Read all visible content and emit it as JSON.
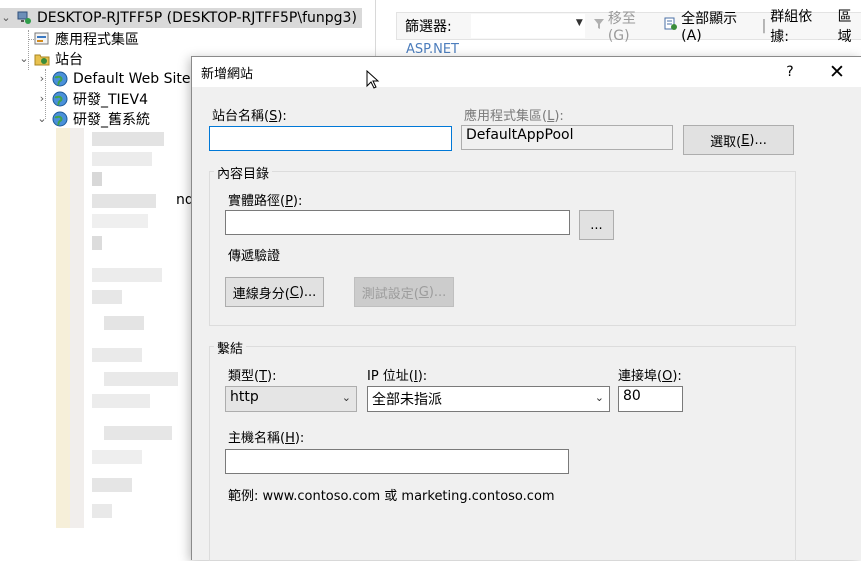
{
  "tree": {
    "server": "DESKTOP-RJTFF5P (DESKTOP-RJTFF5P\\funpg3)",
    "app_pools": "應用程式集區",
    "sites": "站台",
    "site_items": [
      {
        "label": "Default Web Site"
      },
      {
        "label": "研發_TIEV4"
      },
      {
        "label": "研發_舊系統"
      }
    ],
    "partial_text": "nd"
  },
  "right_pane": {
    "filter_label": "篩選器:",
    "go_label": "移至(G)",
    "show_all_label": "全部顯示(A)",
    "group_by_label": "群組依據:",
    "group_by_value": "區域",
    "section_label": "ASP.NET"
  },
  "dialog": {
    "title": "新增網站",
    "help": "?",
    "close": "✕",
    "site_name": {
      "label_pre": "站台名稱(",
      "key": "S",
      "label_post": "):",
      "value": ""
    },
    "app_pool": {
      "label_pre": "應用程式集區(",
      "key": "L",
      "label_post": "):",
      "value": "DefaultAppPool"
    },
    "select_button": {
      "pre": "選取(",
      "key": "E",
      "post": ")..."
    },
    "content_group": {
      "title": "內容目錄",
      "physical_path": {
        "label_pre": "實體路徑(",
        "key": "P",
        "label_post": "):",
        "value": ""
      },
      "browse_button": "...",
      "pass_through": "傳遞驗證",
      "connect_as": {
        "pre": "連線身分(",
        "key": "C",
        "post": ")..."
      },
      "test_settings": {
        "pre": "測試設定(",
        "key": "G",
        "post": ")..."
      }
    },
    "binding_group": {
      "title": "繫結",
      "type": {
        "label_pre": "類型(",
        "key": "T",
        "label_post": "):",
        "value": "http"
      },
      "ip": {
        "label_pre": "IP 位址(",
        "key": "I",
        "label_post": "):",
        "value": "全部未指派"
      },
      "port": {
        "label_pre": "連接埠(",
        "key": "O",
        "label_post": "):",
        "value": "80"
      },
      "host": {
        "label_pre": "主機名稱(",
        "key": "H",
        "label_post": "):",
        "value": ""
      },
      "example": "範例: www.contoso.com 或 marketing.contoso.com"
    }
  },
  "icons": {
    "server": "server-icon",
    "app_pools": "app-pools-icon",
    "sites": "sites-folder-icon",
    "site": "globe-icon",
    "cursor": "mouse-pointer-icon"
  }
}
